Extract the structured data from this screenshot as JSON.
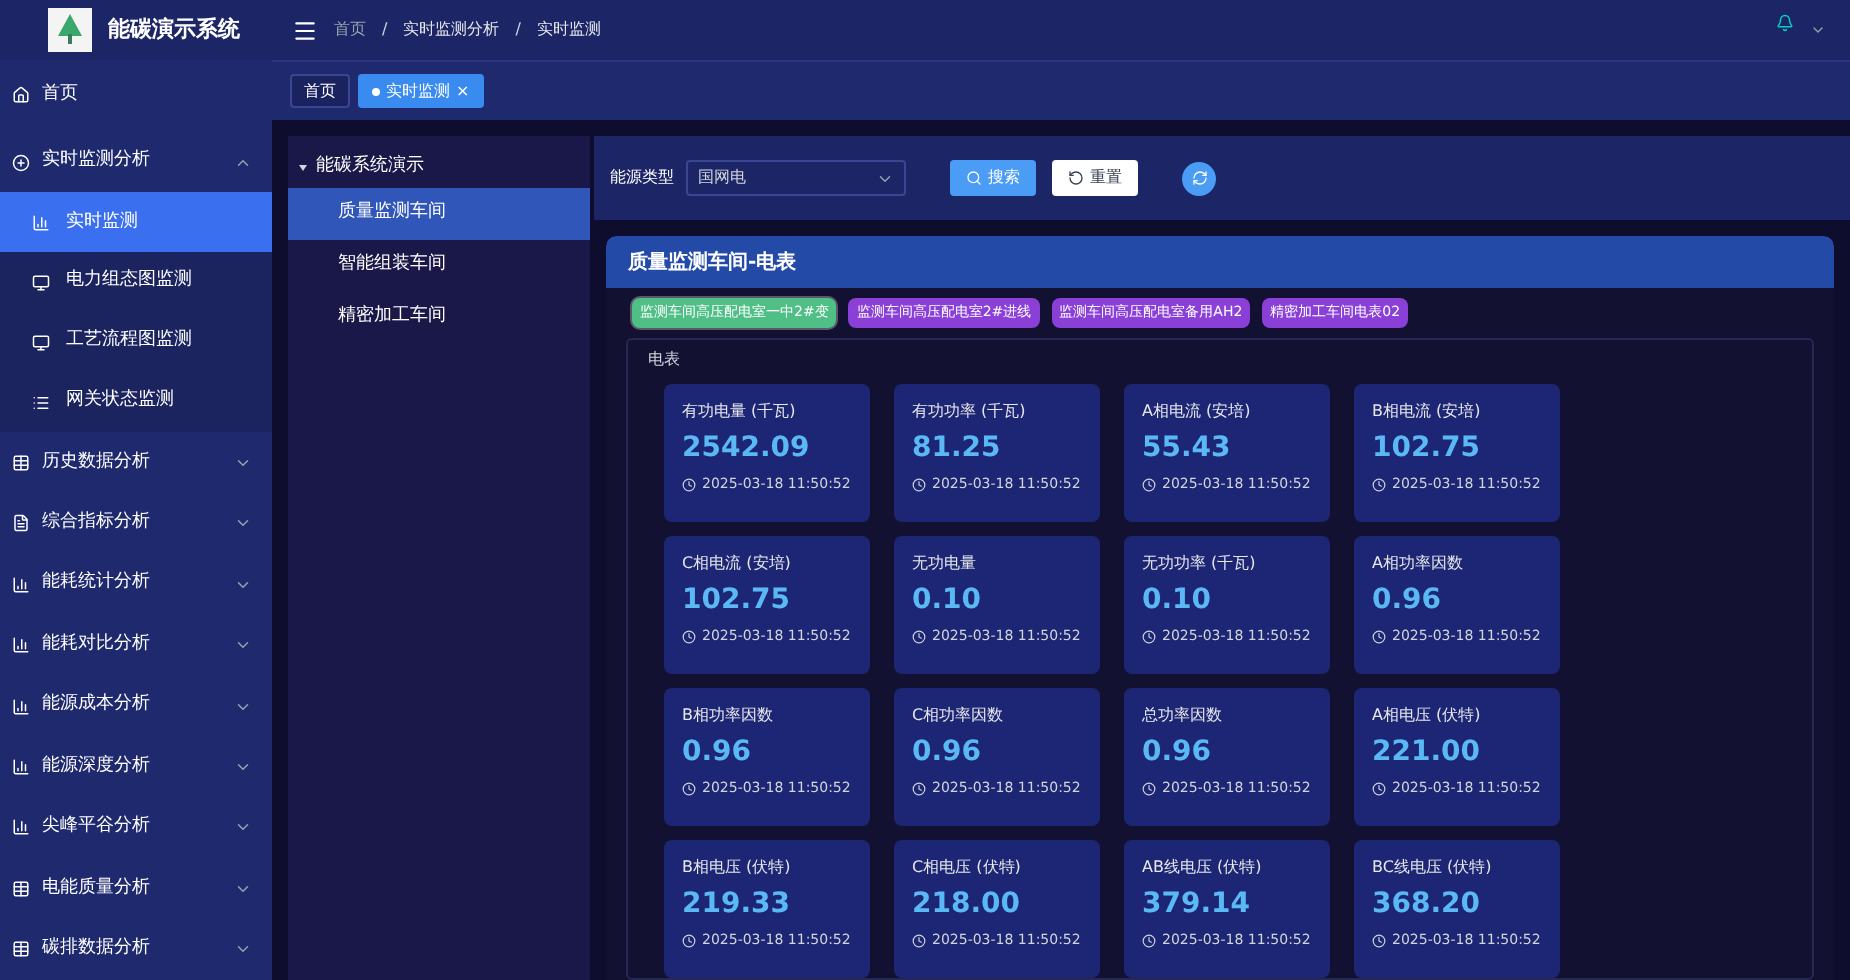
{
  "app": {
    "title": "能碳演示系统"
  },
  "breadcrumb": [
    "首页",
    "实时监测分析",
    "实时监测"
  ],
  "breadcrumb_separator": "/",
  "tabs": [
    {
      "label": "首页",
      "selected": false
    },
    {
      "label": "实时监测",
      "selected": true,
      "close": "×"
    }
  ],
  "sidebar": {
    "items": [
      {
        "label": "首页",
        "selected": false
      },
      {
        "label": "实时监测分析",
        "expanded": true,
        "selected": false,
        "children": [
          {
            "label": "实时监测",
            "selected": true
          },
          {
            "label": "电力组态图监测",
            "selected": false
          },
          {
            "label": "工艺流程图监测",
            "selected": false
          },
          {
            "label": "网关状态监测",
            "selected": false
          }
        ]
      },
      {
        "label": "历史数据分析",
        "expanded": false,
        "selected": false
      },
      {
        "label": "综合指标分析",
        "expanded": false,
        "selected": false
      },
      {
        "label": "能耗统计分析",
        "expanded": false,
        "selected": false
      },
      {
        "label": "能耗对比分析",
        "expanded": false,
        "selected": false
      },
      {
        "label": "能源成本分析",
        "expanded": false,
        "selected": false
      },
      {
        "label": "能源深度分析",
        "expanded": false,
        "selected": false
      },
      {
        "label": "尖峰平谷分析",
        "expanded": false,
        "selected": false
      },
      {
        "label": "电能质量分析",
        "expanded": false,
        "selected": false
      },
      {
        "label": "碳排数据分析",
        "expanded": false,
        "selected": false
      }
    ]
  },
  "tree": {
    "label": "能碳系统演示",
    "expanded": true,
    "children": [
      {
        "label": "质量监测车间",
        "selected": true
      },
      {
        "label": "智能组装车间",
        "selected": false
      },
      {
        "label": "精密加工车间",
        "selected": false
      }
    ]
  },
  "filter": {
    "label": "能源类型",
    "value": "国网电",
    "search": "搜索",
    "reset": "重置"
  },
  "panel": {
    "title": "质量监测车间-电表",
    "meters": [
      {
        "label": "监测车间高压配电室一中2#变",
        "color": "#4fbf86",
        "selected": true
      },
      {
        "label": "监测车间高压配电室2#进线",
        "color": "#8a3fd6",
        "selected": false
      },
      {
        "label": "监测车间高压配电室备用AH2",
        "color": "#8a3fd6",
        "selected": false
      },
      {
        "label": "精密加工车间电表02",
        "color": "#8a3fd6",
        "selected": false
      }
    ],
    "section": "电表",
    "cards": [
      {
        "label": "有功电量 (千瓦)",
        "value": "2542.09",
        "time": "2025-03-18 11:50:52"
      },
      {
        "label": "有功功率 (千瓦)",
        "value": "81.25",
        "time": "2025-03-18 11:50:52"
      },
      {
        "label": "A相电流 (安培)",
        "value": "55.43",
        "time": "2025-03-18 11:50:52"
      },
      {
        "label": "B相电流 (安培)",
        "value": "102.75",
        "time": "2025-03-18 11:50:52"
      },
      {
        "label": "C相电流 (安培)",
        "value": "102.75",
        "time": "2025-03-18 11:50:52"
      },
      {
        "label": "无功电量",
        "value": "0.10",
        "time": "2025-03-18 11:50:52"
      },
      {
        "label": "无功功率 (千瓦)",
        "value": "0.10",
        "time": "2025-03-18 11:50:52"
      },
      {
        "label": "A相功率因数",
        "value": "0.96",
        "time": "2025-03-18 11:50:52"
      },
      {
        "label": "B相功率因数",
        "value": "0.96",
        "time": "2025-03-18 11:50:52"
      },
      {
        "label": "C相功率因数",
        "value": "0.96",
        "time": "2025-03-18 11:50:52"
      },
      {
        "label": "总功率因数",
        "value": "0.96",
        "time": "2025-03-18 11:50:52"
      },
      {
        "label": "A相电压 (伏特)",
        "value": "221.00",
        "time": "2025-03-18 11:50:52"
      },
      {
        "label": "B相电压 (伏特)",
        "value": "219.33",
        "time": "2025-03-18 11:50:52"
      },
      {
        "label": "C相电压 (伏特)",
        "value": "218.00",
        "time": "2025-03-18 11:50:52"
      },
      {
        "label": "AB线电压 (伏特)",
        "value": "379.14",
        "time": "2025-03-18 11:50:52"
      },
      {
        "label": "BC线电压 (伏特)",
        "value": "368.20",
        "time": "2025-03-18 11:50:52"
      }
    ]
  }
}
